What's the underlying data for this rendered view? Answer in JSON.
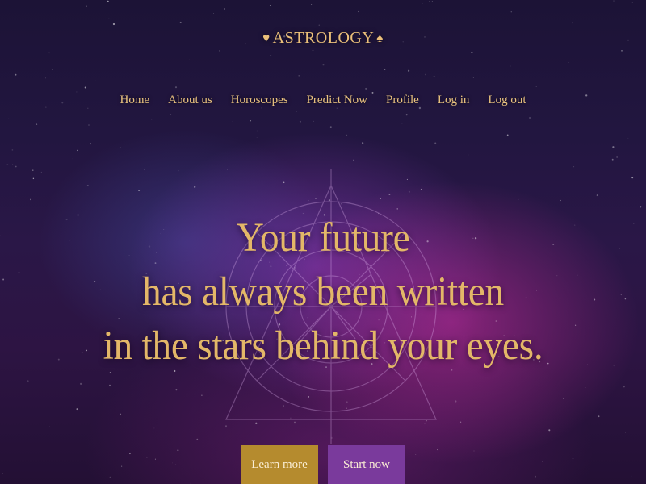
{
  "brand": {
    "name": "ASTROLOGY",
    "left_glyph": "♥",
    "right_glyph": "♠"
  },
  "nav": {
    "items": [
      {
        "label": "Home"
      },
      {
        "label": "About us"
      },
      {
        "label": "Horoscopes"
      },
      {
        "label": "Predict Now"
      },
      {
        "label": "Profile"
      },
      {
        "label": "Log in"
      },
      {
        "label": "Log out"
      }
    ]
  },
  "hero": {
    "lines": [
      "Your future",
      "has always been written",
      "in the stars behind your eyes."
    ]
  },
  "buttons": {
    "learn_more": "Learn more",
    "start_now": "Start now"
  },
  "colors": {
    "accent_gold": "#e3b768",
    "button_gold": "#b58b2e",
    "button_purple": "#7a3a9c",
    "background_dark": "#1c1336"
  }
}
